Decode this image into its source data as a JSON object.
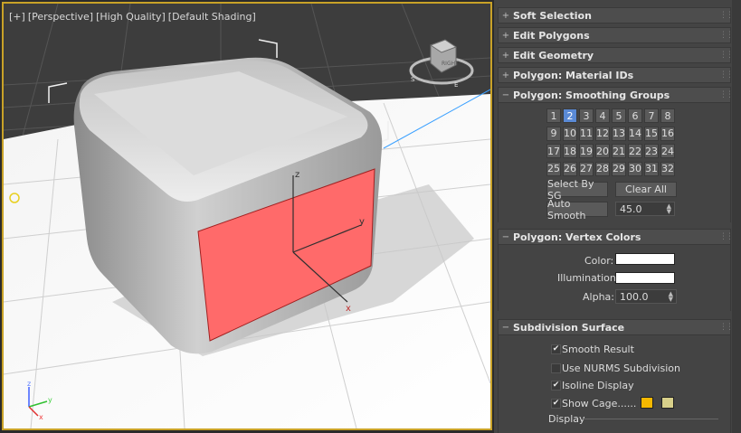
{
  "viewport": {
    "label_parts": [
      "[+]",
      "[Perspective]",
      "[High Quality]",
      "[Default Shading]"
    ],
    "viewcube": {
      "face_label": "RIGHT",
      "compass": [
        "S",
        "E"
      ]
    },
    "gizmo_axes": [
      "z",
      "y",
      "x"
    ],
    "tripod_axes": [
      "z",
      "y",
      "x"
    ],
    "colors": {
      "selected_face": "#ff6a6a",
      "border": "#c9a227"
    }
  },
  "panel": {
    "rollouts": [
      {
        "sign": "+",
        "title": "Soft Selection"
      },
      {
        "sign": "+",
        "title": "Edit Polygons"
      },
      {
        "sign": "+",
        "title": "Edit Geometry"
      },
      {
        "sign": "+",
        "title": "Polygon: Material IDs"
      },
      {
        "sign": "−",
        "title": "Polygon: Smoothing Groups"
      },
      {
        "sign": "−",
        "title": "Polygon: Vertex Colors"
      },
      {
        "sign": "−",
        "title": "Subdivision Surface"
      }
    ],
    "smoothing": {
      "groups": [
        "1",
        "2",
        "3",
        "4",
        "5",
        "6",
        "7",
        "8",
        "9",
        "10",
        "11",
        "12",
        "13",
        "14",
        "15",
        "16",
        "17",
        "18",
        "19",
        "20",
        "21",
        "22",
        "23",
        "24",
        "25",
        "26",
        "27",
        "28",
        "29",
        "30",
        "31",
        "32"
      ],
      "active": "2",
      "select_by_sg": "Select By SG",
      "clear_all": "Clear All",
      "auto_smooth": "Auto Smooth",
      "threshold": "45.0"
    },
    "vertex_colors": {
      "color_label": "Color:",
      "illumination_label": "Illumination:",
      "alpha_label": "Alpha:",
      "alpha_value": "100.0",
      "color_value": "#ffffff",
      "illumination_value": "#ffffff"
    },
    "subdivision": {
      "smooth_result": "Smooth Result",
      "use_nurms": "Use NURMS Subdivision",
      "isoline_display": "Isoline Display",
      "show_cage": "Show Cage......",
      "display_group": "Display",
      "cage_colors": [
        "#f5b800",
        "#d8d08a"
      ],
      "checked": {
        "smooth_result": true,
        "use_nurms": false,
        "isoline_display": true,
        "show_cage": true
      }
    }
  }
}
